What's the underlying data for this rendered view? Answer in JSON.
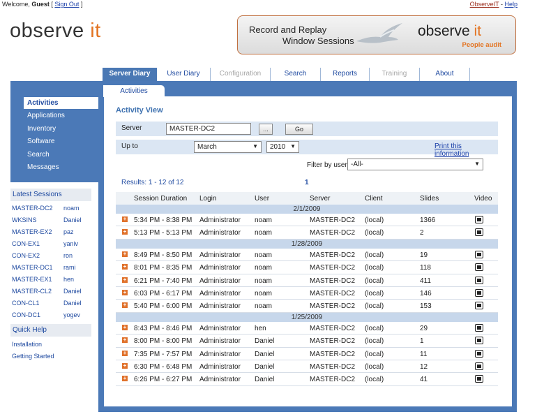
{
  "header": {
    "welcome_prefix": "Welcome,",
    "user": "Guest",
    "sign_out": "Sign Out",
    "observeit_link": "ObserveIT",
    "help_link": "Help"
  },
  "logo": {
    "part1": "observe ",
    "part2": "it"
  },
  "banner": {
    "line1": "Record and Replay",
    "line2": "Window Sessions",
    "logo_part1": "observe ",
    "logo_part2": "it",
    "tagline": "People audit"
  },
  "nav": {
    "tabs": [
      "Server Diary",
      "User Diary",
      "Configuration",
      "Search",
      "Reports",
      "Training",
      "About"
    ]
  },
  "subtab": "Activities",
  "sidebar": {
    "items": [
      "Activities",
      "Applications",
      "Inventory",
      "Software",
      "Search",
      "Messages"
    ]
  },
  "latest_sessions": {
    "title": "Latest Sessions",
    "rows": [
      {
        "server": "MASTER-DC2",
        "user": "noam"
      },
      {
        "server": "WKSINS",
        "user": "Daniel"
      },
      {
        "server": "MASTER-EX2",
        "user": "paz"
      },
      {
        "server": "CON-EX1",
        "user": "yaniv"
      },
      {
        "server": "CON-EX2",
        "user": "ron"
      },
      {
        "server": "MASTER-DC1",
        "user": "rami"
      },
      {
        "server": "MASTER-EX1",
        "user": "hen"
      },
      {
        "server": "MASTER-CL2",
        "user": "Daniel"
      },
      {
        "server": "CON-CL1",
        "user": "Daniel"
      },
      {
        "server": "CON-DC1",
        "user": "yogev"
      }
    ]
  },
  "quick_help": {
    "title": "Quick Help",
    "links": [
      "Installation",
      "Getting Started"
    ]
  },
  "activity_view": {
    "title": "Activity View",
    "server_label": "Server",
    "server_value": "MASTER-DC2",
    "browse_label": "...",
    "go_label": "Go",
    "upto_label": "Up to",
    "month": "March",
    "year": "2010",
    "print_link": "Print this information",
    "filter_label": "Filter by user",
    "filter_value": "-All-",
    "results_text": "Results: 1 - 12 of 12",
    "page": "1"
  },
  "table": {
    "columns": [
      "Session Duration",
      "Login",
      "User",
      "Server",
      "Client",
      "Slides",
      "Video"
    ],
    "groups": [
      {
        "date": "2/1/2009",
        "rows": [
          {
            "duration": "5:34 PM - 8:38 PM",
            "login": "Administrator",
            "user": "noam",
            "server": "MASTER-DC2",
            "client": "(local)",
            "slides": "1366"
          },
          {
            "duration": "5:13 PM - 5:13 PM",
            "login": "Administrator",
            "user": "noam",
            "server": "MASTER-DC2",
            "client": "(local)",
            "slides": "2"
          }
        ]
      },
      {
        "date": "1/28/2009",
        "rows": [
          {
            "duration": "8:49 PM - 8:50 PM",
            "login": "Administrator",
            "user": "noam",
            "server": "MASTER-DC2",
            "client": "(local)",
            "slides": "19"
          },
          {
            "duration": "8:01 PM - 8:35 PM",
            "login": "Administrator",
            "user": "noam",
            "server": "MASTER-DC2",
            "client": "(local)",
            "slides": "118"
          },
          {
            "duration": "6:21 PM - 7:40 PM",
            "login": "Administrator",
            "user": "noam",
            "server": "MASTER-DC2",
            "client": "(local)",
            "slides": "411"
          },
          {
            "duration": "6:03 PM - 6:17 PM",
            "login": "Administrator",
            "user": "noam",
            "server": "MASTER-DC2",
            "client": "(local)",
            "slides": "146"
          },
          {
            "duration": "5:40 PM - 6:00 PM",
            "login": "Administrator",
            "user": "noam",
            "server": "MASTER-DC2",
            "client": "(local)",
            "slides": "153"
          }
        ]
      },
      {
        "date": "1/25/2009",
        "rows": [
          {
            "duration": "8:43 PM - 8:46 PM",
            "login": "Administrator",
            "user": "hen",
            "server": "MASTER-DC2",
            "client": "(local)",
            "slides": "29"
          },
          {
            "duration": "8:00 PM - 8:00 PM",
            "login": "Administrator",
            "user": "Daniel",
            "server": "MASTER-DC2",
            "client": "(local)",
            "slides": "1"
          },
          {
            "duration": "7:35 PM - 7:57 PM",
            "login": "Administrator",
            "user": "Daniel",
            "server": "MASTER-DC2",
            "client": "(local)",
            "slides": "11"
          },
          {
            "duration": "6:30 PM - 6:48 PM",
            "login": "Administrator",
            "user": "Daniel",
            "server": "MASTER-DC2",
            "client": "(local)",
            "slides": "12"
          },
          {
            "duration": "6:26 PM - 6:27 PM",
            "login": "Administrator",
            "user": "Daniel",
            "server": "MASTER-DC2",
            "client": "(local)",
            "slides": "41"
          }
        ]
      }
    ]
  },
  "colors": {
    "brand_blue": "#4b79b7",
    "brand_orange": "#e37422",
    "link_blue": "#1f4aa0"
  }
}
